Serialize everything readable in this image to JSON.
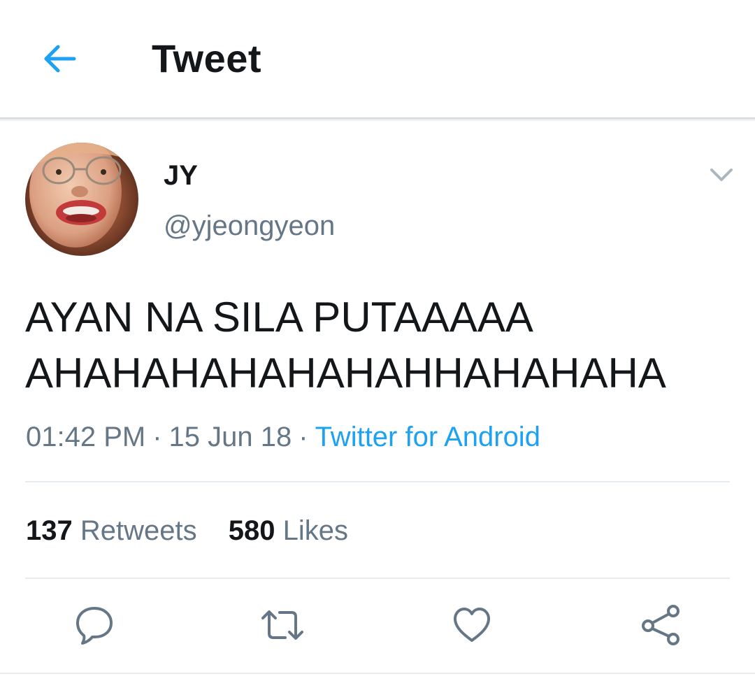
{
  "header": {
    "title": "Tweet",
    "back_icon": "back-arrow-icon"
  },
  "author": {
    "display_name": "JY",
    "handle": "@yjeongyeon",
    "avatar": "user-avatar-photo"
  },
  "tweet": {
    "text_lines": [
      "AYAN NA SILA PUTAAAAA",
      "AHAHAHAHAHAHAHHAHAHAHA"
    ],
    "time": "01:42 PM",
    "date": "15 Jun 18",
    "separator": "·",
    "source": "Twitter for Android"
  },
  "stats": {
    "retweets_count": "137",
    "retweets_label": "Retweets",
    "likes_count": "580",
    "likes_label": "Likes"
  },
  "actions": [
    "reply-icon",
    "retweet-icon",
    "like-icon",
    "share-icon"
  ],
  "colors": {
    "accent": "#1da1f2",
    "text": "#14171a",
    "secondary": "#657786",
    "icon": "#657786",
    "divider": "#e6ecf0"
  }
}
